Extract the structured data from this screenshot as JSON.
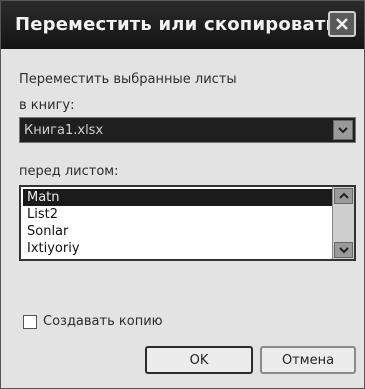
{
  "window": {
    "title": "Переместить или скопировать"
  },
  "form": {
    "move_label": "Переместить выбранные листы",
    "book_label": "в книгу:",
    "book_value": "Книга1.xlsx",
    "before_label": "перед листом:",
    "sheets": [
      "Matn",
      "List2",
      "Sonlar",
      "Ixtiyoriy"
    ],
    "selected_sheet": "Matn",
    "copy_label": "Создавать копию",
    "copy_checked": false
  },
  "buttons": {
    "ok": "OK",
    "cancel": "Отмена"
  },
  "icons": {
    "close": "close-icon",
    "dropdown": "chevron-down-icon",
    "scroll_up": "scroll-up-icon",
    "scroll_down": "scroll-down-icon"
  }
}
